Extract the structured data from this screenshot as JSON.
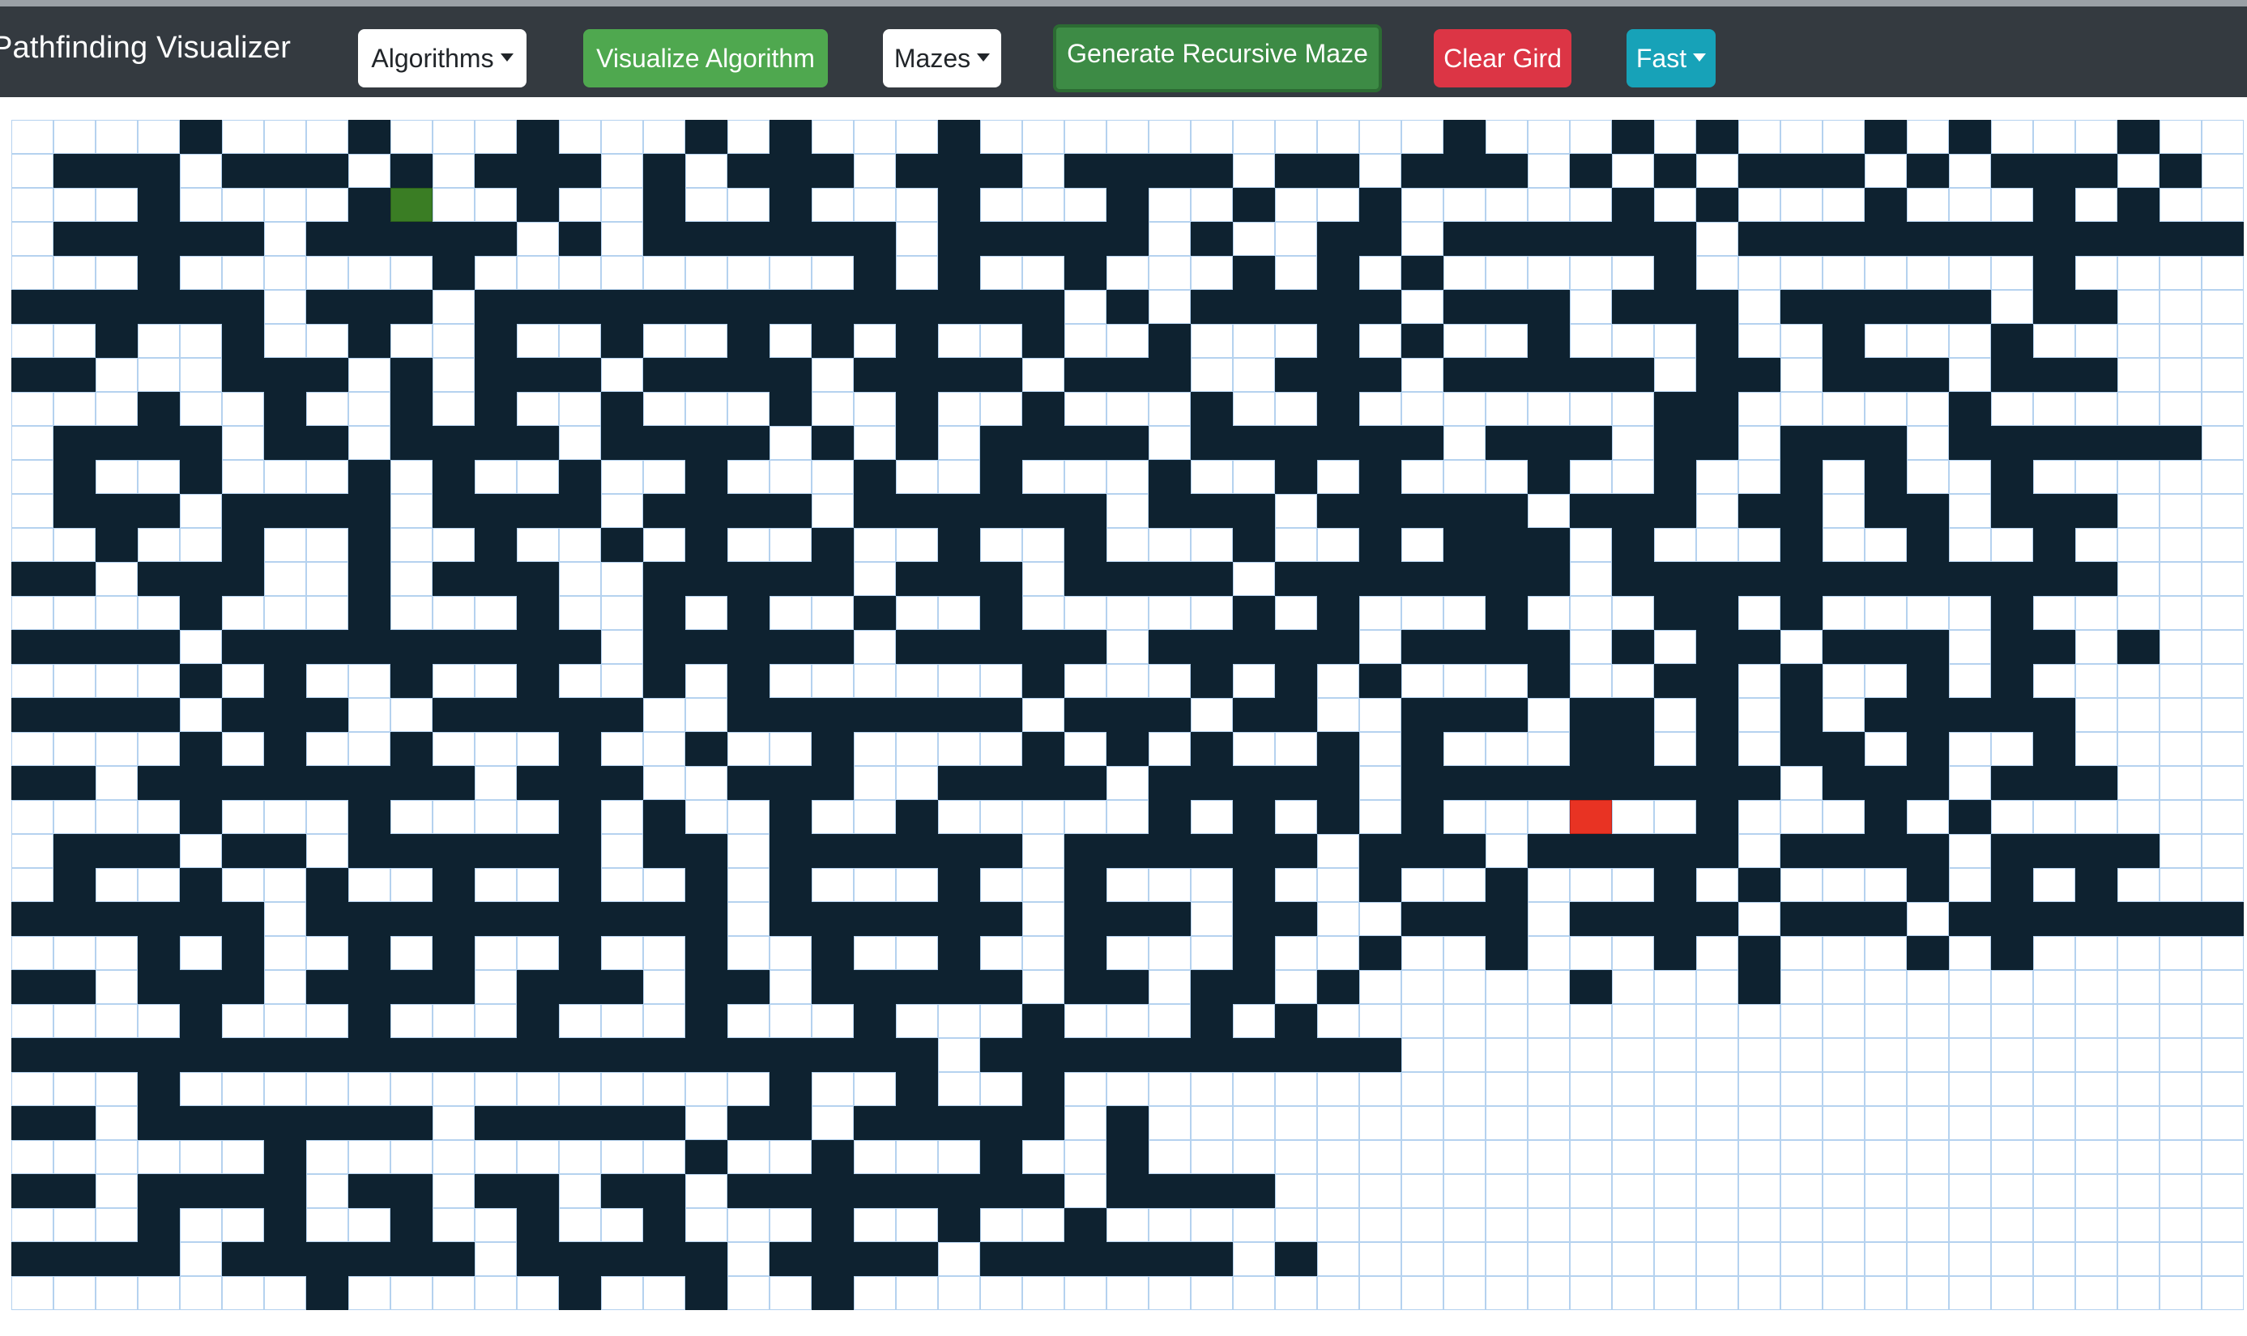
{
  "navbar": {
    "brand": "Pathfinding Visualizer",
    "algorithms_label": "Algorithms",
    "visualize_label": "Visualize Algorithm",
    "mazes_label": "Mazes",
    "generate_maze_label": "Generate Recursive Maze",
    "clear_label": "Clear Gird",
    "speed_label": "Fast"
  },
  "colors": {
    "navbar_bg": "#343a40",
    "wall": "#0e2230",
    "start_node": "#3a7d24",
    "target_node": "#e83323",
    "grid_line": "#b5d2ef",
    "visualize_button": "#4fa84f",
    "clear_button": "#dc3545",
    "speed_button": "#17a2b8"
  },
  "grid": {
    "rows": 35,
    "cols": 53,
    "legend": "#=wall, S=start node, T=target node, o=wall being placed (animation), .=empty",
    "cells": [
      "....#...#...#...#.#...#...........#...#.#...#.#...#..",
      ".###.###.#.###.#.###.###.####.##.###.#.#.###.#.###.#.",
      "...#....#S..#..#..#...#...#..#..#.....#.#...#...#.#..",
      ".#####.#####.#.######.#####.#..##.######.###############",
      "...#......#.........#.#..#...#.#.#.....#........#...",
      "######.###.##############.#.#####.###.###.#####.##.",
      "..#..#..#..#..#..#.#.#..#..#...#.#..#...#..#...#..",
      "##...###.#.###.####.####.###..###.#####.##.###.###.",
      "...#..#..#.#..#...#..#..#...#..#.......##.....#..",
      ".####.##.####.####.#.#.####.######.###.##.###.######",
      ".#..#...#.#..#..#...#..#...#..#.#...#..#..#.#..#.",
      ".###.####.####.####.######.###.#####.###.##.##.###.",
      "..#..#..#..#..#.#..#..#..#...#..#.###.#...#..#..#.",
      "##.###..#.###..#####.###.####.#######.############",
      "....#...#...#..#.#..#..#.....#.#...#...##.#....#.",
      "####.#########.#####.#####.#####.####.#.##.###.##.#",
      "....#.#..#..#..#.#......#...#.#.#...#..##.#..#.#..",
      "####.###..#####..#######.###.##..###.##.#.#.#####.",
      "....#.#..#...#..#..#....#.#.#..#.#...##.#.##.#..#.",
      "##.########.###..###..####.#####.#########.###.###.",
      "....#...#....#.#..#..#.....#.#.#.#...T..#...#.#..",
      ".###.##.######.##.######.######.###.#####.####.####.",
      ".#..#..#..#..#..#.#...#..#...#..#..#...#.#...#.#.#",
      "######.##########.######.###.##..###.####.###.#######",
      "...#.#..#.#..#..#..#..#..#...#..#..#...#.#...#.#..",
      "##.###.####.###.##.#####.##.##.#.....#...#..........",
      "....#...#...#...#...#...#...#.#..................",
      "######################.##########..........................",
      "...#..............#..#..#..................................",
      "##.#######.#####.##.#####.#...................................",
      "......#.........#..#...#..#...................................",
      "##.####.##.##.##.########.####....................................",
      "...#..#..#..#..#...#..#..#.........................................",
      "####.######.#####.####.######.#.......................................",
      ".......#.....#..#..#...................................................."
    ]
  }
}
